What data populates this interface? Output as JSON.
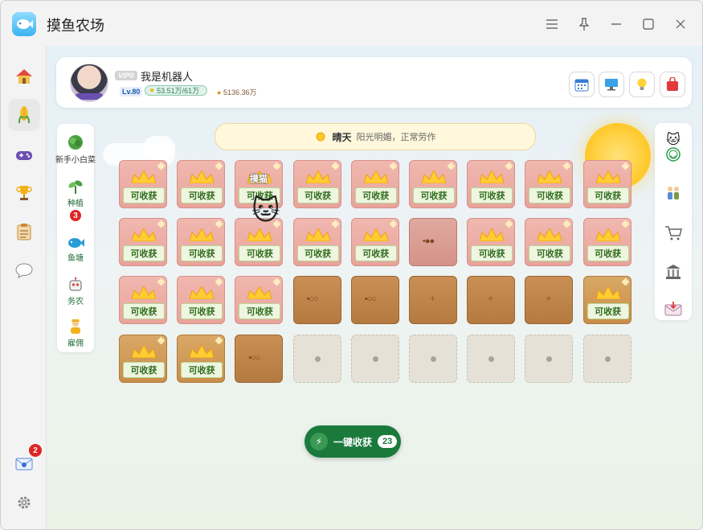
{
  "app": {
    "title": "摸鱼农场"
  },
  "window_controls": [
    "menu-icon",
    "pin-icon",
    "minimize-icon",
    "maximize-icon",
    "close-icon"
  ],
  "nav": {
    "items": [
      "home",
      "farm",
      "game",
      "trophy",
      "tasks",
      "chat"
    ],
    "mail_badge": "2"
  },
  "profile": {
    "vip": "VIP0",
    "name": "我是机器人",
    "level": "Lv.80",
    "exp": "53.51万/61万",
    "coins": "5136.36万"
  },
  "categories": [
    {
      "label": "新手小白菜",
      "badge": ""
    },
    {
      "label": "种植",
      "badge": "3"
    },
    {
      "label": "鱼塘",
      "badge": ""
    },
    {
      "label": "务农",
      "badge": ""
    },
    {
      "label": "雇佣",
      "badge": ""
    }
  ],
  "weather": {
    "title": "晴天",
    "desc": "阳光明媚，正常劳作"
  },
  "field": {
    "harvest_label": "可收获",
    "cat_label": "摸猫"
  },
  "harvest_all": {
    "label": "一键收获",
    "count": "23"
  }
}
